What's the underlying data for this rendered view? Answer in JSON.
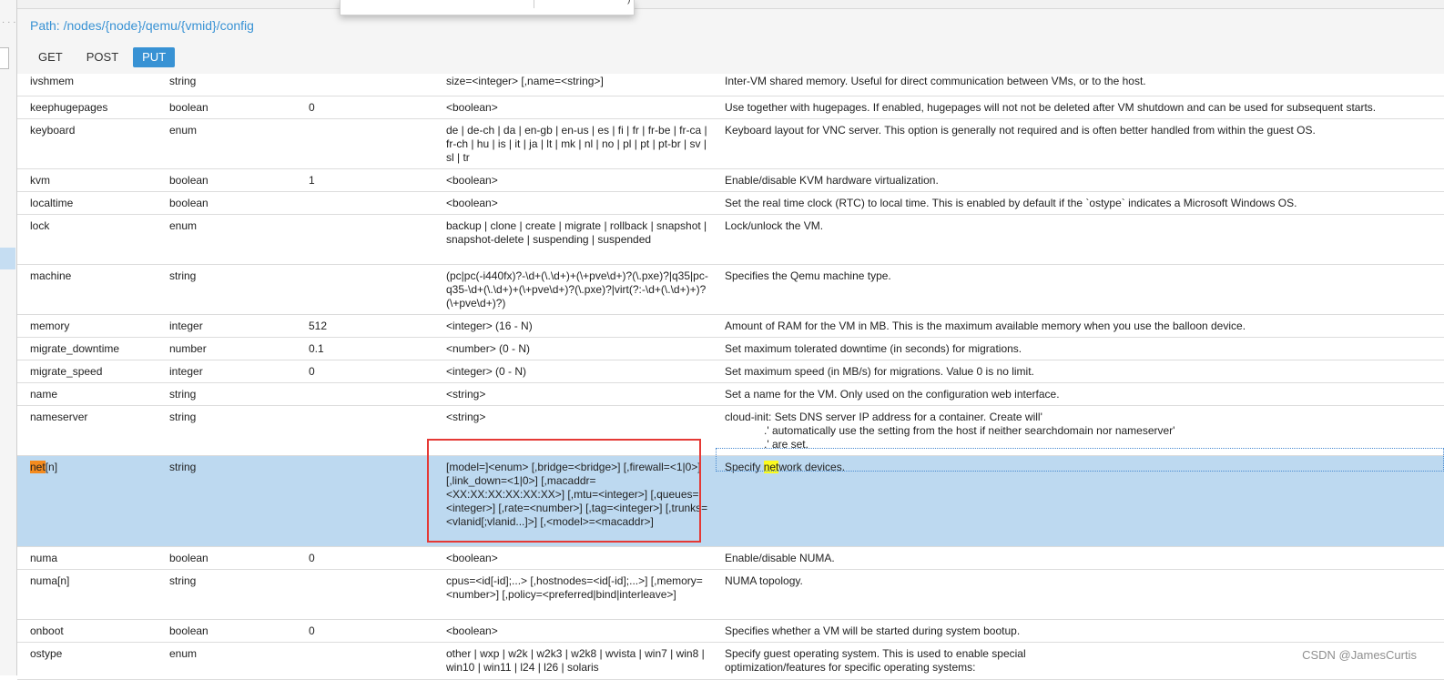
{
  "header": {
    "path_label": "Path: /nodes/{node}/qemu/{vmid}/config",
    "methods": [
      "GET",
      "POST",
      "PUT"
    ],
    "active_method": "PUT"
  },
  "rows": [
    {
      "name": "ivshmem",
      "type": "string",
      "default": "",
      "format": "size=<integer> [,name=<string>]",
      "description": "Inter-VM shared memory. Useful for direct communication between VMs, or to the host."
    },
    {
      "name": "keephugepages",
      "type": "boolean",
      "default": "0",
      "format": "<boolean>",
      "description": "Use together with hugepages. If enabled, hugepages will not not be deleted after VM shutdown and can be used for subsequent starts."
    },
    {
      "name": "keyboard",
      "type": "enum",
      "default": "",
      "format": "de | de-ch | da | en-gb | en-us | es | fi | fr | fr-be | fr-ca | fr-ch | hu | is | it | ja | lt | mk | nl | no | pl | pt | pt-br | sv | sl | tr",
      "description": "Keyboard layout for VNC server. This option is generally not required and is often better handled from within the guest OS."
    },
    {
      "name": "kvm",
      "type": "boolean",
      "default": "1",
      "format": "<boolean>",
      "description": "Enable/disable KVM hardware virtualization."
    },
    {
      "name": "localtime",
      "type": "boolean",
      "default": "",
      "format": "<boolean>",
      "description": "Set the real time clock (RTC) to local time. This is enabled by default if the `ostype` indicates a Microsoft Windows OS."
    },
    {
      "name": "lock",
      "type": "enum",
      "default": "",
      "format": "backup | clone | create | migrate | rollback | snapshot | snapshot-delete | suspending | suspended",
      "description": "Lock/unlock the VM."
    },
    {
      "name": "machine",
      "type": "string",
      "default": "",
      "format": "(pc|pc(-i440fx)?-\\d+(\\.\\d+)+(\\+pve\\d+)?(\\.pxe)?|q35|pc-q35-\\d+(\\.\\d+)+(\\+pve\\d+)?(\\.pxe)?|virt(?:-\\d+(\\.\\d+)+)?(\\+pve\\d+)?)",
      "description": "Specifies the Qemu machine type."
    },
    {
      "name": "memory",
      "type": "integer",
      "default": "512",
      "format": "<integer> (16 - N)",
      "description": "Amount of RAM for the VM in MB. This is the maximum available memory when you use the balloon device."
    },
    {
      "name": "migrate_downtime",
      "type": "number",
      "default": "0.1",
      "format": "<number> (0 - N)",
      "description": "Set maximum tolerated downtime (in seconds) for migrations."
    },
    {
      "name": "migrate_speed",
      "type": "integer",
      "default": "0",
      "format": "<integer> (0 - N)",
      "description": "Set maximum speed (in MB/s) for migrations. Value 0 is no limit."
    },
    {
      "name": "name",
      "type": "string",
      "default": "",
      "format": "<string>",
      "description": "Set a name for the VM. Only used on the configuration web interface."
    },
    {
      "name": "nameserver",
      "type": "string",
      "default": "",
      "format": "<string>",
      "description_lines": [
        "cloud-init: Sets DNS server IP address for a container. Create will'",
        ".' automatically use the setting from the host if neither searchdomain nor nameserver'",
        ".' are set."
      ]
    },
    {
      "name_hl": "net",
      "name_rest": "[n]",
      "type": "string",
      "default": "",
      "format": "[model=]<enum> [,bridge=<bridge>] [,firewall=<1|0>] [,link_down=<1|0>] [,macaddr=<XX:XX:XX:XX:XX:XX>] [,mtu=<integer>] [,queues=<integer>] [,rate=<number>] [,tag=<integer>] [,trunks=<vlanid[;vlanid...]>] [,<model>=<macaddr>]",
      "desc_pre": "Specify ",
      "desc_hl": "net",
      "desc_post": "work devices."
    },
    {
      "name": "numa",
      "type": "boolean",
      "default": "0",
      "format": "<boolean>",
      "description": "Enable/disable NUMA."
    },
    {
      "name": "numa[n]",
      "type": "string",
      "default": "",
      "format": "cpus=<id[-id];...> [,hostnodes=<id[-id];...>] [,memory=<number>] [,policy=<preferred|bind|interleave>]",
      "description": "NUMA topology."
    },
    {
      "name": "onboot",
      "type": "boolean",
      "default": "0",
      "format": "<boolean>",
      "description": "Specifies whether a VM will be started during system bootup."
    },
    {
      "name": "ostype",
      "type": "enum",
      "default": "",
      "format": "other | wxp | w2k | w2k3 | w2k8 | wvista | win7 | win8 | win10 | win11 | l24 | l26 | solaris",
      "description": "Specify guest operating system. This is used to enable special optimization/features for specific operating systems:"
    }
  ],
  "watermark": "CSDN @JamesCurtis"
}
